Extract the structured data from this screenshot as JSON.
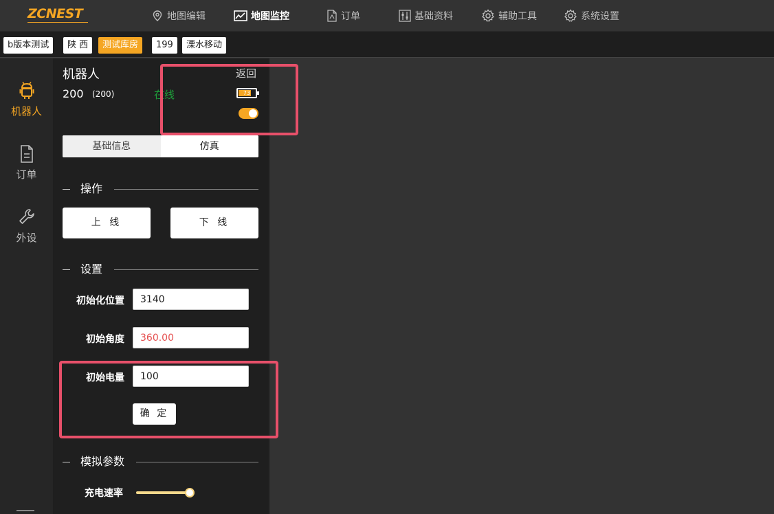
{
  "logo": {
    "text": "ZCNEST"
  },
  "nav": {
    "items": [
      {
        "label": "地图编辑",
        "icon": "map-pin-icon"
      },
      {
        "label": "地图监控",
        "icon": "chart-line-icon",
        "active": true
      },
      {
        "label": "订单",
        "icon": "document-icon"
      },
      {
        "label": "基础资料",
        "icon": "sliders-icon"
      },
      {
        "label": "辅助工具",
        "icon": "gear-icon"
      },
      {
        "label": "系统设置",
        "icon": "gear-icon"
      }
    ]
  },
  "tags": [
    "b版本测试",
    "陕 西",
    "测试库房",
    "199",
    "溧水移动"
  ],
  "active_tag": "测试库房",
  "sidebar": {
    "items": [
      {
        "label": "机器人",
        "icon": "android-robot-icon",
        "active": true
      },
      {
        "label": "订单",
        "icon": "document-icon"
      },
      {
        "label": "外设",
        "icon": "wrench-icon"
      }
    ]
  },
  "robot": {
    "title": "机器人",
    "back": "返回",
    "id": "200",
    "id_sub": "(200)",
    "status": "在线",
    "battery": "73",
    "battery_level": 0.73,
    "switch_on": true
  },
  "tabs": [
    "基础信息",
    "仿真"
  ],
  "active_tab": "仿真",
  "sections": {
    "operation": "操作",
    "settings": "设置",
    "simulation": "模拟参数"
  },
  "buttons": {
    "online": "上 线",
    "offline": "下 线",
    "confirm": "确 定"
  },
  "fields": {
    "init_position": {
      "label": "初始化位置",
      "value": "3140"
    },
    "init_angle": {
      "label": "初始角度",
      "value": "360.00"
    },
    "init_battery": {
      "label": "初始电量",
      "value": "100"
    }
  },
  "slider": {
    "label": "充电速率",
    "level": 1.0
  },
  "colors": {
    "accent": "#f5a623",
    "online_status": "#1e9e3a",
    "highlight": "#e8506a",
    "error_text": "#e55050"
  }
}
